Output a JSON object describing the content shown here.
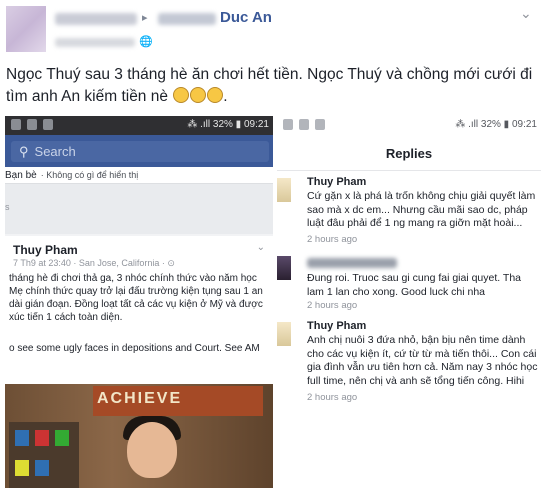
{
  "post": {
    "author_name": "Duc An",
    "arrow": "▸",
    "text": "Ngọc Thuý sau 3 tháng hè ăn chơi hết tiền. Ngọc Thuý và chồng mới cưới đi tìm anh An kiếm tiền nè",
    "globe": "🌐",
    "chevron": "⌄"
  },
  "left_screenshot": {
    "status": {
      "time": "09:21",
      "battery": "32%",
      "signal": "⁂ .ıll"
    },
    "search_placeholder": "Search",
    "friends_label": "Bạn bè",
    "friends_sub": "· Không có gì để hiển thị",
    "gap_label": "s",
    "post_author": "Thuy Pham",
    "post_meta": "7 Th9 at 23:40 · San Jose, California · ⊙",
    "post_text": "tháng hè đi chơi thả ga, 3 nhóc chính thức vào năm học Mẹ chính thức quay trở lại đấu trường kiện tụng sau 1 an dài gián đoạn. Đồng loạt tất cả các vụ kiện ở Mỹ và được xúc tiến 1 cách toàn diện.",
    "post_text2": "o see some ugly faces in depositions and Court. See AM",
    "photo_letters": "ACHIEVE"
  },
  "right_screenshot": {
    "status": {
      "time": "09:21",
      "battery": "32%",
      "signal": "⁂ .ıll"
    },
    "title": "Replies",
    "replies": [
      {
        "name": "Thuy Pham",
        "text": "Cứ gặn x là phá là trốn không chịu giải quyết làm sao mà x dc em... Nhưng cầu mãi sao dc, pháp luật đâu phải để 1 ng mang ra giỡn mặt hoài...",
        "time": "2 hours ago"
      },
      {
        "name": "",
        "text": "Đung roi. Truoc sau gi cung fai giai quyet. Tha lam 1 lan cho xong. Good luck chi nha",
        "time": "2 hours ago"
      },
      {
        "name": "Thuy Pham",
        "text": "Anh chị nuôi 3 đứa nhỏ, bận bịu nên time dành cho các vụ kiện ít, cứ từ từ mà tiến thôi... Con cái gia đình vẫn ưu tiên hơn cả. Năm nay 3 nhóc học full time, nên chị và anh sẽ tổng tiến công. Hihi",
        "time": "2 hours ago"
      }
    ]
  }
}
